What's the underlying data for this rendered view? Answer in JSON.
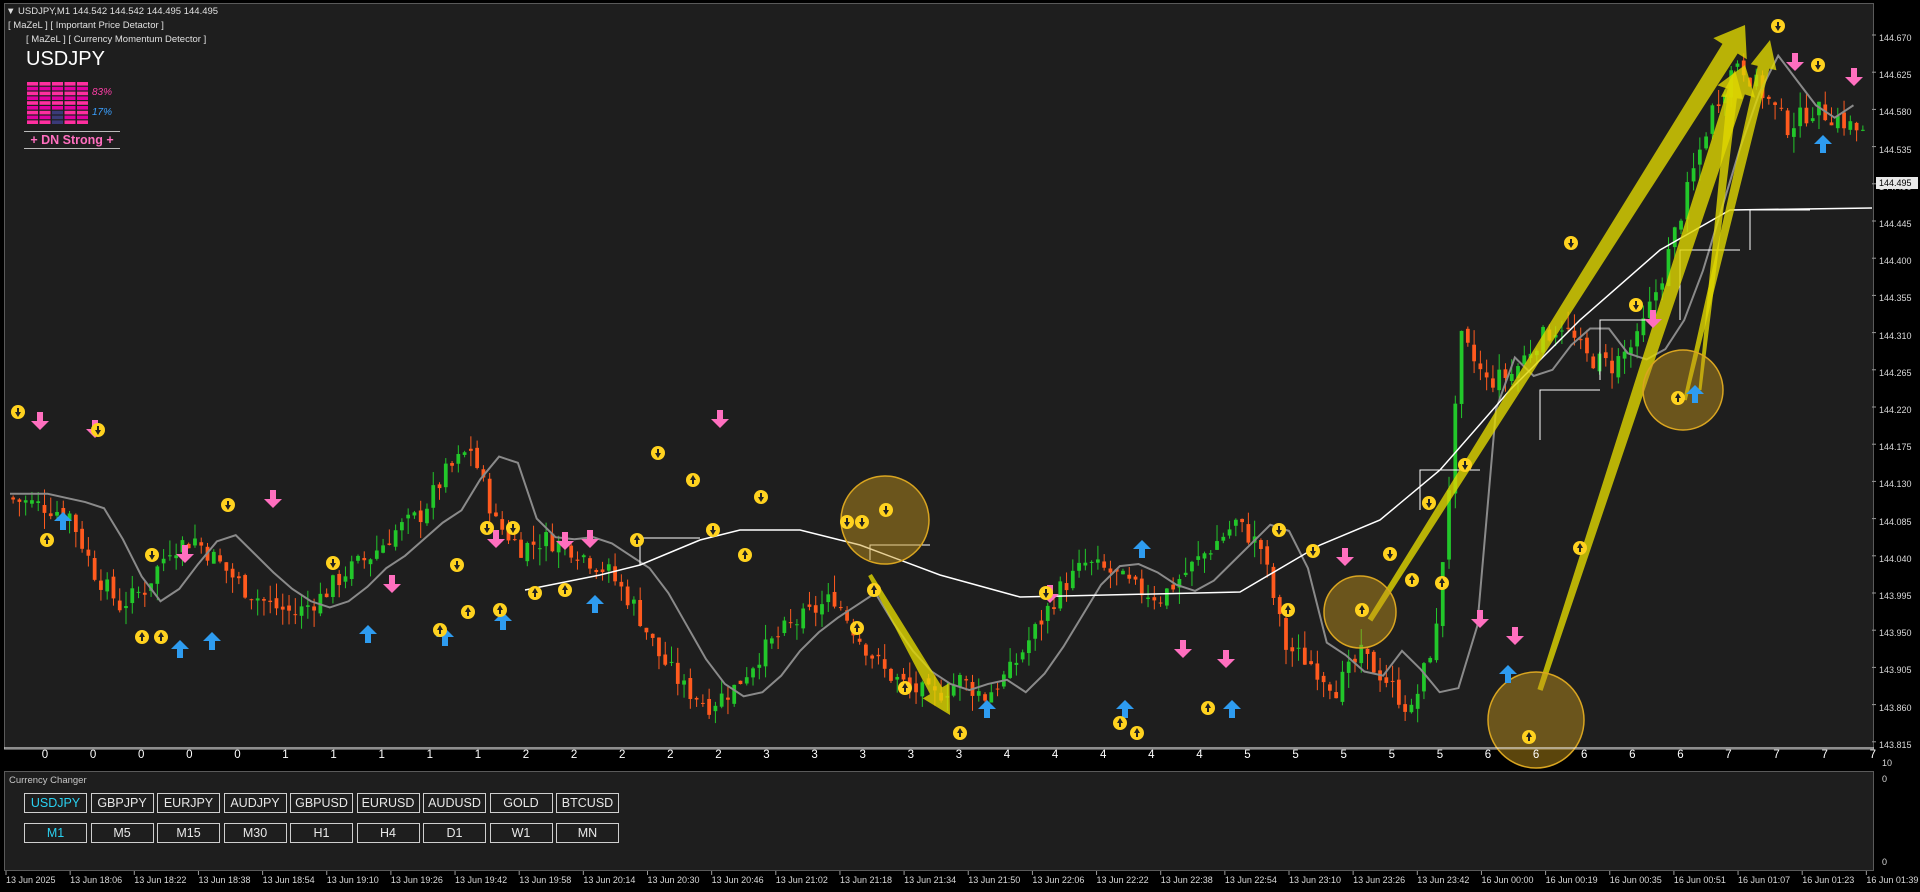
{
  "window": {
    "header_line": "▼ USDJPY,M1  144.542 144.542 144.495 144.495",
    "indicator_1": "[ MaZeL ] [ Important Price Detactor ]",
    "indicator_2": "[ MaZeL ] [ Currency Momentum Detector ]"
  },
  "panel": {
    "symbol": "USDJPY",
    "up_percent": "83%",
    "down_percent": "17%",
    "signal": "+ DN Strong +"
  },
  "price_axis": {
    "ticks": [
      "144.670",
      "144.625",
      "144.580",
      "144.535",
      "144.490",
      "144.445",
      "144.400",
      "144.355",
      "144.310",
      "144.265",
      "144.220",
      "144.175",
      "144.130",
      "144.085",
      "144.040",
      "143.995",
      "143.950",
      "143.905",
      "143.860",
      "143.815"
    ],
    "current_price": "144.495"
  },
  "sub_axis": {
    "ticks": [
      "10",
      "0",
      "0"
    ]
  },
  "counter_row": [
    "0",
    "0",
    "0",
    "0",
    "0",
    "1",
    "1",
    "1",
    "1",
    "1",
    "2",
    "2",
    "2",
    "2",
    "2",
    "3",
    "3",
    "3",
    "3",
    "3",
    "4",
    "4",
    "4",
    "4",
    "4",
    "5",
    "5",
    "5",
    "5",
    "5",
    "6",
    "6",
    "6",
    "6",
    "6",
    "7",
    "7",
    "7",
    "7"
  ],
  "time_axis": [
    "13 Jun 2025",
    "13 Jun 18:06",
    "13 Jun 18:22",
    "13 Jun 18:38",
    "13 Jun 18:54",
    "13 Jun 19:10",
    "13 Jun 19:26",
    "13 Jun 19:42",
    "13 Jun 19:58",
    "13 Jun 20:14",
    "13 Jun 20:30",
    "13 Jun 20:46",
    "13 Jun 21:02",
    "13 Jun 21:18",
    "13 Jun 21:34",
    "13 Jun 21:50",
    "13 Jun 22:06",
    "13 Jun 22:22",
    "13 Jun 22:38",
    "13 Jun 22:54",
    "13 Jun 23:10",
    "13 Jun 23:26",
    "13 Jun 23:42",
    "16 Jun 00:00",
    "16 Jun 00:19",
    "16 Jun 00:35",
    "16 Jun 00:51",
    "16 Jun 01:07",
    "16 Jun 01:23",
    "16 Jun 01:39"
  ],
  "currency_changer": {
    "title": "Currency Changer",
    "symbols": [
      "USDJPY",
      "GBPJPY",
      "EURJPY",
      "AUDJPY",
      "GBPUSD",
      "EURUSD",
      "AUDUSD",
      "GOLD",
      "BTCUSD"
    ],
    "active_symbol": "USDJPY",
    "timeframes": [
      "M1",
      "M5",
      "M15",
      "M30",
      "H1",
      "H4",
      "D1",
      "W1",
      "MN"
    ],
    "active_timeframe": "M1"
  },
  "colors": {
    "bull": "#22c72a",
    "bear": "#ff5a1e",
    "up_arrow": "#2e9cf0",
    "down_arrow": "#ff6fbf",
    "marker": "#ffd21f",
    "highlight": "#e0d700",
    "accent": "#2ad0f0",
    "background": "#1e1e1e"
  },
  "chart_data": {
    "type": "candlestick",
    "symbol": "USDJPY",
    "timeframe": "M1",
    "ylim": [
      143.815,
      144.68
    ],
    "close_path": [
      [
        0,
        144.11
      ],
      [
        6,
        144.1
      ],
      [
        10,
        144.09
      ],
      [
        14,
        144.02
      ],
      [
        18,
        143.98
      ],
      [
        22,
        144.0
      ],
      [
        26,
        144.05
      ],
      [
        30,
        144.06
      ],
      [
        34,
        144.03
      ],
      [
        38,
        144.0
      ],
      [
        42,
        143.98
      ],
      [
        46,
        143.97
      ],
      [
        50,
        143.99
      ],
      [
        54,
        144.02
      ],
      [
        58,
        144.04
      ],
      [
        62,
        144.07
      ],
      [
        66,
        144.09
      ],
      [
        70,
        144.14
      ],
      [
        74,
        144.17
      ],
      [
        78,
        144.08
      ],
      [
        82,
        144.05
      ],
      [
        86,
        144.06
      ],
      [
        90,
        144.05
      ],
      [
        94,
        144.03
      ],
      [
        96,
        144.02
      ],
      [
        100,
        143.98
      ],
      [
        104,
        143.92
      ],
      [
        108,
        143.88
      ],
      [
        112,
        143.86
      ],
      [
        116,
        143.88
      ],
      [
        120,
        143.92
      ],
      [
        124,
        143.95
      ],
      [
        128,
        143.97
      ],
      [
        132,
        143.99
      ],
      [
        136,
        143.94
      ],
      [
        140,
        143.9
      ],
      [
        144,
        143.88
      ],
      [
        148,
        143.87
      ],
      [
        152,
        143.89
      ],
      [
        156,
        143.87
      ],
      [
        160,
        143.9
      ],
      [
        164,
        143.95
      ],
      [
        168,
        144.0
      ],
      [
        172,
        144.03
      ],
      [
        176,
        144.02
      ],
      [
        180,
        144.0
      ],
      [
        184,
        143.99
      ],
      [
        188,
        144.02
      ],
      [
        192,
        144.05
      ],
      [
        196,
        144.08
      ],
      [
        200,
        144.05
      ],
      [
        204,
        143.93
      ],
      [
        208,
        143.91
      ],
      [
        212,
        143.88
      ],
      [
        216,
        143.92
      ],
      [
        220,
        143.89
      ],
      [
        224,
        143.85
      ],
      [
        228,
        143.95
      ],
      [
        232,
        144.3
      ],
      [
        236,
        144.25
      ],
      [
        240,
        144.26
      ],
      [
        244,
        144.3
      ],
      [
        248,
        144.32
      ],
      [
        252,
        144.28
      ],
      [
        256,
        144.27
      ],
      [
        260,
        144.3
      ],
      [
        264,
        144.38
      ],
      [
        268,
        144.48
      ],
      [
        272,
        144.58
      ],
      [
        276,
        144.64
      ],
      [
        280,
        144.6
      ],
      [
        284,
        144.56
      ],
      [
        288,
        144.58
      ],
      [
        292,
        144.57
      ],
      [
        296,
        144.55
      ]
    ]
  }
}
